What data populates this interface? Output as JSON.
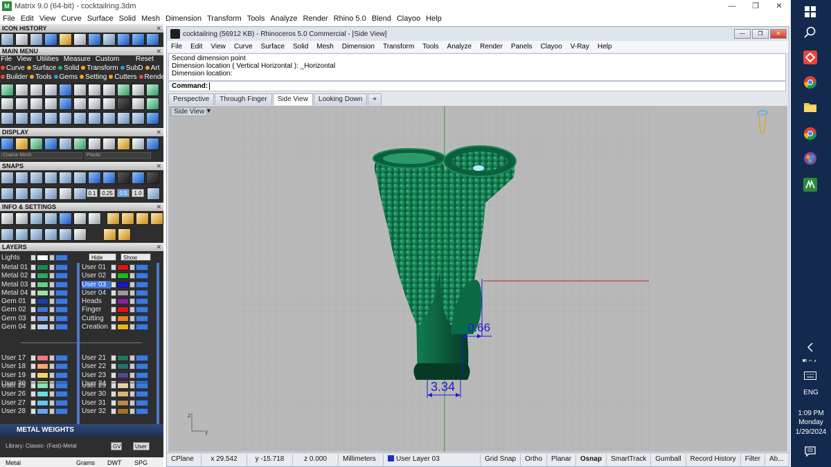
{
  "matrix": {
    "title": "Matrix 9.0 (64-bit) - cocktailring.3dm",
    "app_icon": "M",
    "window_buttons": [
      "—",
      "❐",
      "✕"
    ],
    "menu": [
      "File",
      "Edit",
      "View",
      "Curve",
      "Surface",
      "Solid",
      "Mesh",
      "Dimension",
      "Transform",
      "Tools",
      "Analyze",
      "Render",
      "Rhino 5.0",
      "Blend",
      "Clayoo",
      "Help"
    ]
  },
  "left_panel": {
    "icon_history": "ICON HISTORY",
    "main_menu": "MAIN MENU",
    "main_menu_items": [
      "File",
      "View",
      "Utilities",
      "Measure",
      "Custom"
    ],
    "reset_label": "Reset",
    "sub_row1": [
      "Curve",
      "Surface",
      "Solid",
      "Transform",
      "SubD",
      "Art"
    ],
    "sub_row2": [
      "Builder",
      "Tools",
      "Gems",
      "Setting",
      "Cutters",
      "Render"
    ],
    "display": "DISPLAY",
    "display_mesh": "Coarse Mesh",
    "display_material": "Plastic",
    "snaps": "SNAPS",
    "snap_values": [
      "0.1",
      "0.25",
      "0.5",
      "1.0"
    ],
    "info_settings": "INFO & SETTINGS",
    "layers": "LAYERS",
    "close_glyph": "✕",
    "lights_label": "Lights",
    "hide_label": "Hide",
    "show_label": "Show",
    "layers_left": [
      {
        "name": "Metal 01",
        "color": "#1e8a4c"
      },
      {
        "name": "Metal 02",
        "color": "#2ea85e"
      },
      {
        "name": "Metal 03",
        "color": "#5fd47f"
      },
      {
        "name": "Metal 04",
        "color": "#9ae3a6"
      },
      {
        "name": "Gem 01",
        "color": "#1b3fa8"
      },
      {
        "name": "Gem 02",
        "color": "#3f72d6"
      },
      {
        "name": "Gem 03",
        "color": "#7fa6ea"
      },
      {
        "name": "Gem 04",
        "color": "#b7cdf2"
      },
      {
        "name": "User 17",
        "color": "#f07a7a"
      },
      {
        "name": "User 18",
        "color": "#f3a86a"
      },
      {
        "name": "User 19",
        "color": "#f6d56b"
      },
      {
        "name": "User 20",
        "color": "#c7e36e"
      },
      {
        "name": "User 25",
        "color": "#7ee3b8"
      },
      {
        "name": "User 26",
        "color": "#66e0e0"
      },
      {
        "name": "User 27",
        "color": "#64c8f0"
      },
      {
        "name": "User 28",
        "color": "#6aa3f0"
      }
    ],
    "layers_right": [
      {
        "name": "User 01",
        "color": "#e01414"
      },
      {
        "name": "User 02",
        "color": "#1fb81f"
      },
      {
        "name": "User 03",
        "color": "#1414d8",
        "selected": true
      },
      {
        "name": "User 04",
        "color": "#9a9a9a"
      },
      {
        "name": "Heads",
        "color": "#8a1fa8"
      },
      {
        "name": "Finger",
        "color": "#e01414"
      },
      {
        "name": "Cutting",
        "color": "#f07a1a"
      },
      {
        "name": "Creation",
        "color": "#f0b21a"
      },
      {
        "name": "User 21",
        "color": "#1e7a5a"
      },
      {
        "name": "User 22",
        "color": "#28706a"
      },
      {
        "name": "User 23",
        "color": "#4c4c8a"
      },
      {
        "name": "User 24",
        "color": "#6a3a7a"
      },
      {
        "name": "User 29",
        "color": "#e8d2a0"
      },
      {
        "name": "User 30",
        "color": "#d8b478"
      },
      {
        "name": "User 31",
        "color": "#b88a48"
      },
      {
        "name": "User 32",
        "color": "#a07030"
      }
    ],
    "metal_weights": "METAL WEIGHTS",
    "library": "Library: Classic- (Fast)-Metal",
    "gv_label": "GV",
    "user_label": "User",
    "table_headers": [
      "Metal",
      "Grams",
      "DWT",
      "SPG"
    ]
  },
  "rhino": {
    "title": "cocktailring (56912 KB) - Rhinoceros 5.0 Commercial - [Side View]",
    "window_buttons": [
      "—",
      "❐",
      "✕"
    ],
    "menu": [
      "File",
      "Edit",
      "View",
      "Curve",
      "Surface",
      "Solid",
      "Mesh",
      "Dimension",
      "Transform",
      "Tools",
      "Analyze",
      "Render",
      "Panels",
      "Clayoo",
      "V-Ray",
      "Help"
    ],
    "history": [
      "Second dimension point",
      "Dimension location ( Vertical  Horizontal ): _Horizontal",
      "Dimension location:"
    ],
    "command_label": "Command:",
    "tabs": [
      "Perspective",
      "Through Finger",
      "Side View",
      "Looking Down"
    ],
    "active_tab": "Side View",
    "tab_add_glyph": "⌖",
    "viewport_label": "Side View",
    "dimensions": {
      "small": "0.66",
      "large": "3.34"
    },
    "axis_labels": {
      "z": "z",
      "y": "y"
    },
    "status": {
      "cplane": "CPlane",
      "x": "x 29.542",
      "y": "y -15.718",
      "z": "z 0.000",
      "units": "Millimeters",
      "layer": "User Layer 03",
      "toggles": [
        "Grid Snap",
        "Ortho",
        "Planar",
        "Osnap",
        "SmartTrack",
        "Gumball",
        "Record History",
        "Filter",
        "Ab..."
      ]
    },
    "colors": {
      "ring_green": "#0e6b46",
      "dimension_blue": "#1a1ad6",
      "grid_bg": "#b9b9b9"
    }
  },
  "taskbar": {
    "lang": "ENG",
    "time": "1:09 PM",
    "day": "Monday",
    "date": "1/29/2024"
  }
}
